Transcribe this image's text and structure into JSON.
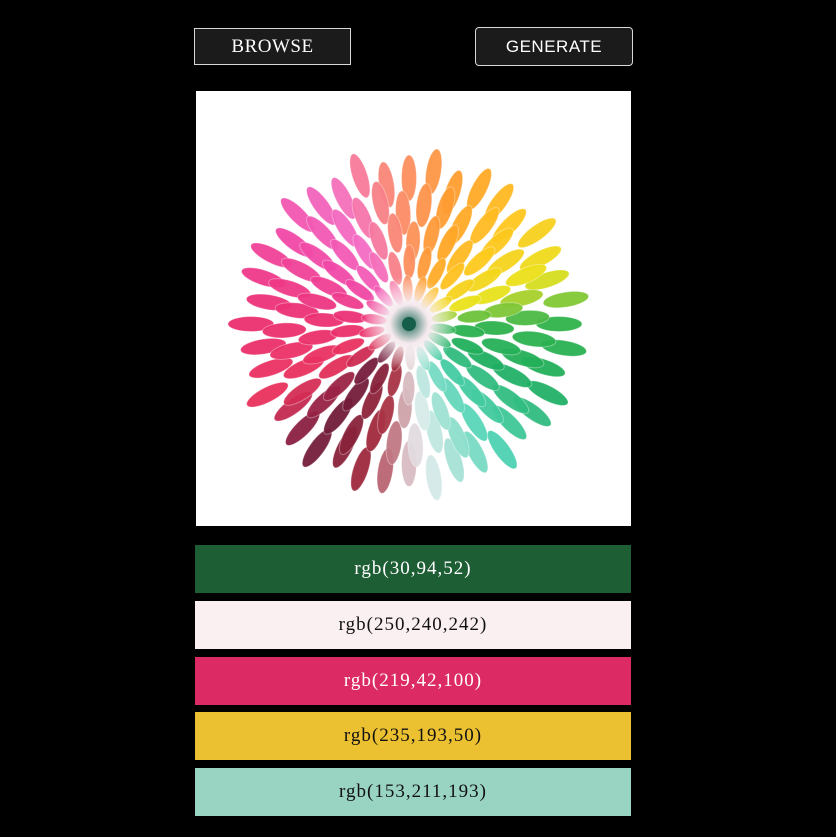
{
  "toolbar": {
    "browse_label": "BROWSE",
    "generate_label": "GENERATE"
  },
  "palette": [
    {
      "label": "rgb(30,94,52)",
      "color": "#1e5e34",
      "text_color": "#ffffff"
    },
    {
      "label": "rgb(250,240,242)",
      "color": "#faf0f2",
      "text_color": "#111111"
    },
    {
      "label": "rgb(219,42,100)",
      "color": "#db2a64",
      "text_color": "#ffffff"
    },
    {
      "label": "rgb(235,193,50)",
      "color": "#ebc132",
      "text_color": "#111111"
    },
    {
      "label": "rgb(153,211,193)",
      "color": "#99d3c1",
      "text_color": "#111111"
    }
  ]
}
